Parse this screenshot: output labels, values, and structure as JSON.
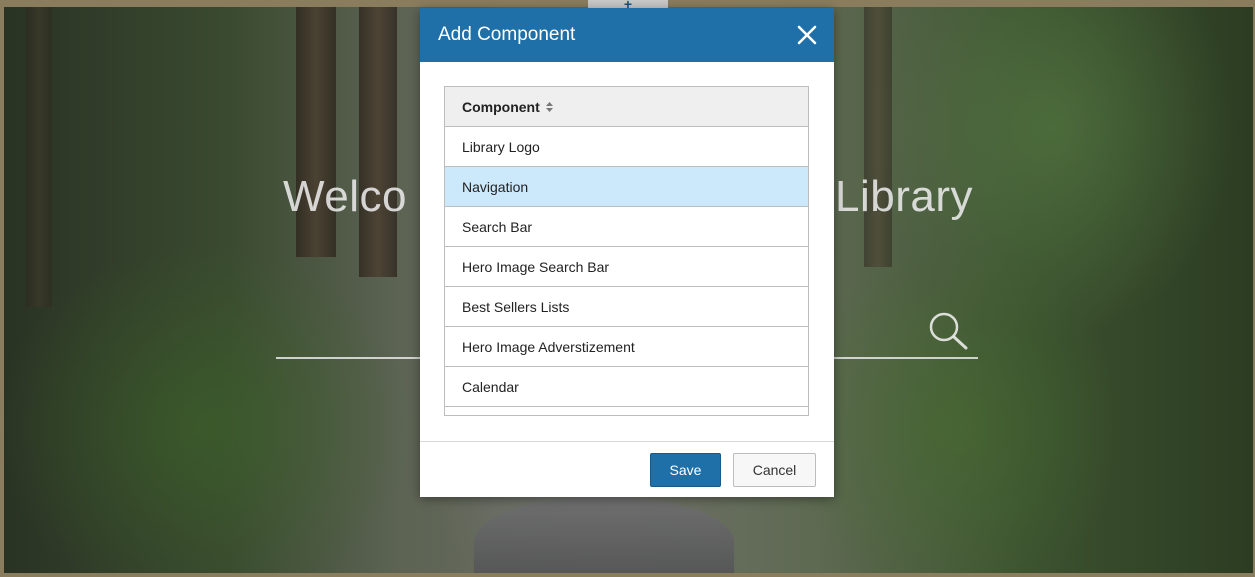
{
  "background": {
    "welcome_left": "Welco",
    "welcome_right": "Library",
    "search_icon": "search-icon"
  },
  "modal": {
    "title": "Add Component",
    "close_icon": "close-icon",
    "table": {
      "column_header": "Component",
      "sort_icon": "sort-icon",
      "rows": [
        {
          "label": "Library Logo",
          "selected": false
        },
        {
          "label": "Navigation",
          "selected": true
        },
        {
          "label": "Search Bar",
          "selected": false
        },
        {
          "label": "Hero Image Search Bar",
          "selected": false
        },
        {
          "label": "Best Sellers Lists",
          "selected": false
        },
        {
          "label": "Hero Image Adverstizement",
          "selected": false
        },
        {
          "label": "Calendar",
          "selected": false
        }
      ]
    },
    "footer": {
      "save_label": "Save",
      "cancel_label": "Cancel"
    }
  },
  "colors": {
    "header": "#1f6fa8",
    "selected_row": "#cce8fb"
  }
}
